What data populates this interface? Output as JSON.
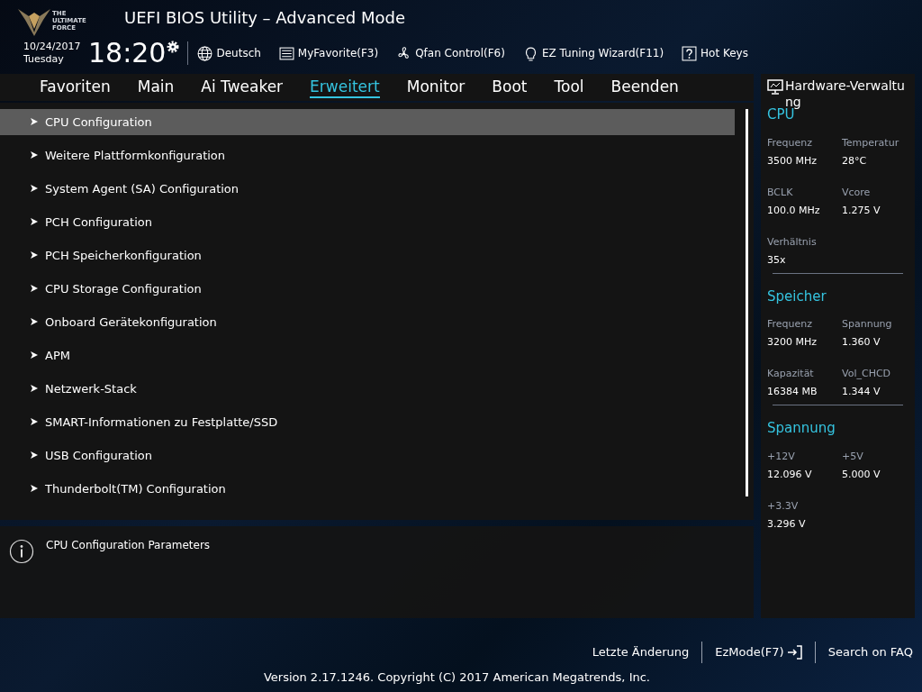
{
  "header": {
    "logo_text": [
      "THE",
      "ULTIMATE",
      "FORCE"
    ],
    "title": "UEFI BIOS Utility – Advanced Mode",
    "date": "10/24/2017",
    "day": "Tuesday",
    "time": "18:20",
    "toolbar": [
      {
        "kind": "globe",
        "label": "Deutsch"
      },
      {
        "kind": "favorite",
        "label": "MyFavorite(F3)"
      },
      {
        "kind": "fan",
        "label": "Qfan Control(F6)"
      },
      {
        "kind": "bulb",
        "label": "EZ Tuning Wizard(F11)"
      },
      {
        "kind": "help",
        "label": "Hot Keys"
      }
    ]
  },
  "tabs": [
    {
      "label": "Favoriten",
      "selected": false
    },
    {
      "label": "Main",
      "selected": false
    },
    {
      "label": "Ai Tweaker",
      "selected": false
    },
    {
      "label": "Erweitert",
      "selected": true
    },
    {
      "label": "Monitor",
      "selected": false
    },
    {
      "label": "Boot",
      "selected": false
    },
    {
      "label": "Tool",
      "selected": false
    },
    {
      "label": "Beenden",
      "selected": false
    }
  ],
  "menu": [
    {
      "label": "CPU Configuration",
      "selected": true
    },
    {
      "label": "Weitere Plattformkonfiguration",
      "selected": false
    },
    {
      "label": "System Agent (SA) Configuration",
      "selected": false
    },
    {
      "label": "PCH Configuration",
      "selected": false
    },
    {
      "label": "PCH Speicherkonfiguration",
      "selected": false
    },
    {
      "label": "CPU Storage Configuration",
      "selected": false
    },
    {
      "label": "Onboard Gerätekonfiguration",
      "selected": false
    },
    {
      "label": "APM",
      "selected": false
    },
    {
      "label": "Netzwerk-Stack",
      "selected": false
    },
    {
      "label": "SMART-Informationen zu Festplatte/SSD",
      "selected": false
    },
    {
      "label": "USB Configuration",
      "selected": false
    },
    {
      "label": "Thunderbolt(TM) Configuration",
      "selected": false
    }
  ],
  "help": {
    "text": "CPU Configuration Parameters"
  },
  "hardware": {
    "title": "Hardware-Verwaltung",
    "sections": [
      {
        "title": "CPU",
        "fields": [
          {
            "label": "Frequenz",
            "value": "3500 MHz"
          },
          {
            "label": "Temperatur",
            "value": "28°C"
          },
          {
            "label": "BCLK",
            "value": "100.0 MHz"
          },
          {
            "label": "Vcore",
            "value": "1.275 V"
          },
          {
            "label": "Verhältnis",
            "value": "35x"
          }
        ]
      },
      {
        "title": "Speicher",
        "fields": [
          {
            "label": "Frequenz",
            "value": "3200 MHz"
          },
          {
            "label": "Spannung",
            "value": "1.360 V"
          },
          {
            "label": "Kapazität",
            "value": "16384 MB"
          },
          {
            "label": "Vol_CHCD",
            "value": "1.344 V"
          }
        ]
      },
      {
        "title": "Spannung",
        "fields": [
          {
            "label": "+12V",
            "value": "12.096 V"
          },
          {
            "label": "+5V",
            "value": "5.000 V"
          },
          {
            "label": "+3.3V",
            "value": "3.296 V"
          }
        ]
      }
    ]
  },
  "footer": {
    "last_change": "Letzte Änderung",
    "ez_mode": "EzMode(F7)",
    "faq": "Search on FAQ",
    "copyright": "Version 2.17.1246. Copyright (C) 2017 American Megatrends, Inc."
  }
}
